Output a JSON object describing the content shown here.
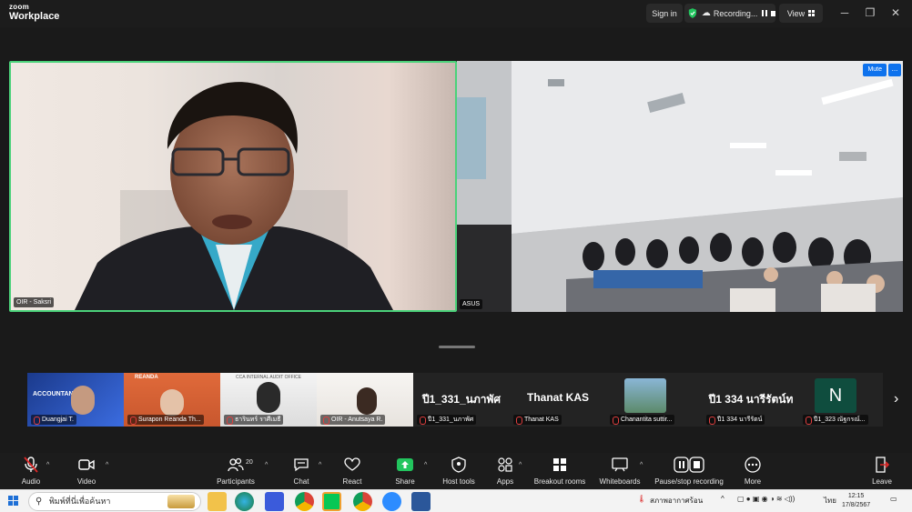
{
  "titlebar": {
    "brand_line1": "zoom",
    "brand_line2": "Workplace",
    "signin": "Sign in",
    "recording": "Recording...",
    "view": "View"
  },
  "main": {
    "left": {
      "name": "OIR - Saksri"
    },
    "right": {
      "name": "ASUS",
      "mute_label": "Mute",
      "more_label": "..."
    }
  },
  "gallery": {
    "items": [
      {
        "name": "Duangjai T.",
        "heading": "ACCOUNTANCY"
      },
      {
        "name": "Surapon Reanda Th...",
        "heading": "REANDA"
      },
      {
        "name": "ธารินทร์ ราศีเมธี",
        "heading": "CCA INTERNAL AUDIT OFFICE"
      },
      {
        "name": "OIR - Anutsaya R.",
        "heading": ""
      },
      {
        "name": "ปี1_331_นภาพัศ",
        "heading": "ปี1_331_นภาพัศ"
      },
      {
        "name": "Thanat KAS",
        "heading": "Thanat KAS"
      },
      {
        "name": "Chanantita suttir...",
        "heading": ""
      },
      {
        "name": "ปี1 334 นารีรัตน์",
        "heading": "ปี1 334 นารีรัตน์ท"
      },
      {
        "name": "ปี1_323 ณัฐกรณ์...",
        "heading": "N"
      }
    ]
  },
  "toolbar": {
    "audio": "Audio",
    "video": "Video",
    "participants": "Participants",
    "participants_count": "20",
    "chat": "Chat",
    "react": "React",
    "share": "Share",
    "host_tools": "Host tools",
    "apps": "Apps",
    "breakout": "Breakout rooms",
    "whiteboards": "Whiteboards",
    "pause_stop": "Pause/stop recording",
    "more": "More",
    "leave": "Leave"
  },
  "taskbar": {
    "search_placeholder": "พิมพ์ที่นี่เพื่อค้นหา",
    "weather": "สภาพอากาศร้อน",
    "lang": "ไทย",
    "time": "12:15",
    "date": "17/8/2567"
  },
  "colors": {
    "active_border": "#4bd27a",
    "accent_blue": "#0e72ed",
    "share_green": "#22c55e",
    "leave_red": "#e02828"
  }
}
